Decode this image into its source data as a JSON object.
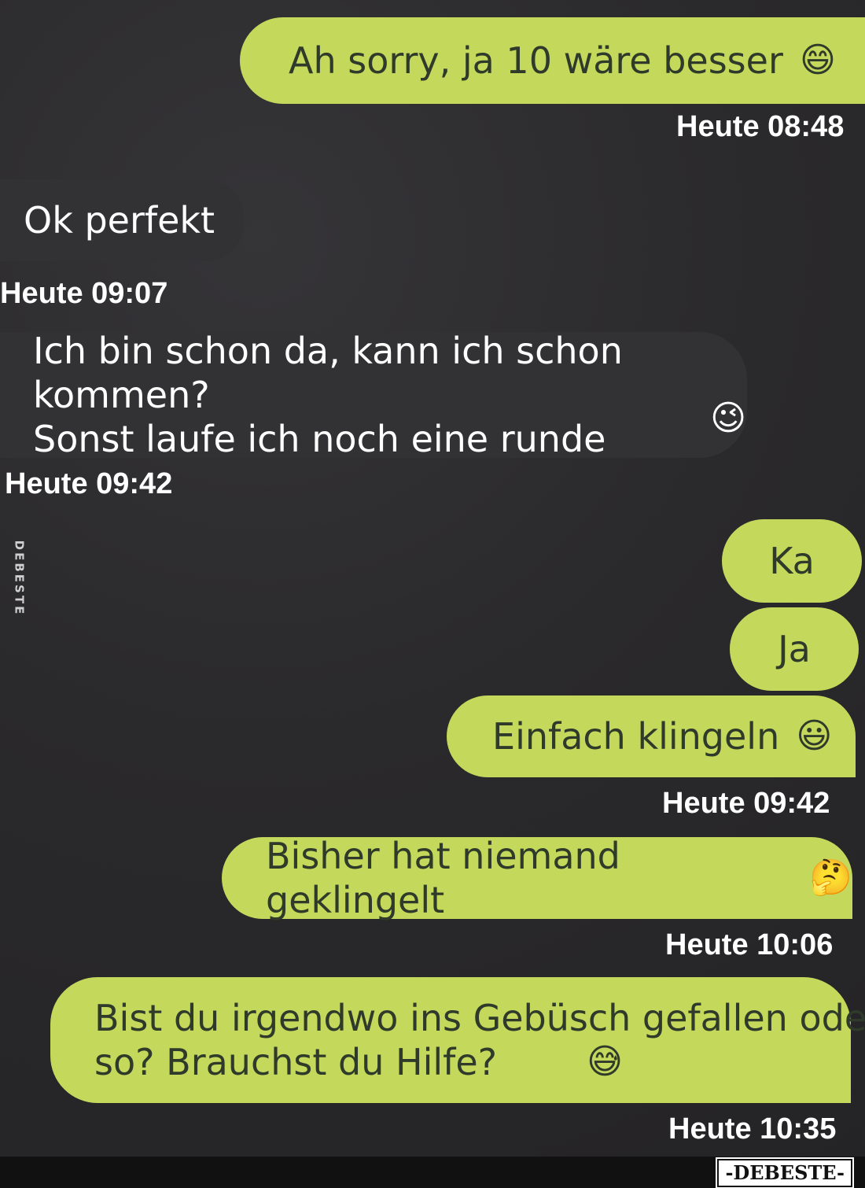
{
  "messages": [
    {
      "text": "Ah sorry, ja 10 wäre besser",
      "emoji": "😄",
      "emoji_name": "grinning-squinting-face-icon"
    },
    {
      "text": "Ok perfekt"
    },
    {
      "text": "Ich bin schon da, kann ich schon kommen?\nSonst laufe ich noch eine runde",
      "emoji": "😉",
      "emoji_name": "winking-face-icon"
    },
    {
      "text": "Ka"
    },
    {
      "text": "Ja"
    },
    {
      "text": "Einfach klingeln",
      "emoji": "😃",
      "emoji_name": "grinning-face-icon"
    },
    {
      "text": "Bisher hat niemand geklingelt",
      "emoji": "🤔",
      "emoji_name": "thinking-face-icon"
    },
    {
      "text": "Bist du irgendwo ins Gebüsch gefallen oder\nso? Brauchst du Hilfe?",
      "emoji": "😅",
      "emoji_name": "grinning-sweat-face-icon"
    }
  ],
  "timestamps": [
    "Heute 08:48",
    "Heute 09:07",
    "Heute 09:42",
    "Heute 09:42",
    "Heute 10:06",
    "Heute 10:35"
  ],
  "watermark": {
    "side": "DEBESTE",
    "brand": "-DEBESTE-"
  },
  "colors": {
    "outgoing_bubble": "#c4d85c",
    "incoming_bubble": "#323134",
    "background": "#2b2a2c"
  }
}
